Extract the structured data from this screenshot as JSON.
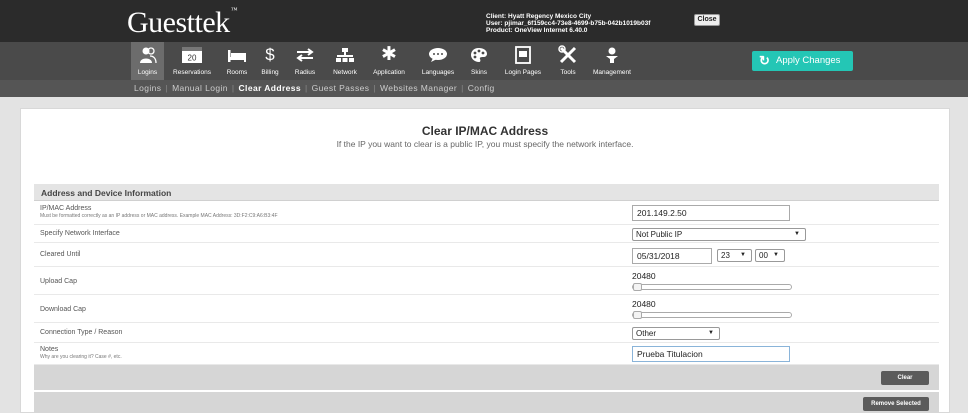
{
  "header": {
    "logo": "Guesttek",
    "trademark": "™",
    "client_line": "Client: Hyatt Regency Mexico City",
    "user_line": "User: pjimar_6f159cc4-73e8-4699-b75b-042b1019b03f",
    "product_line": "Product: OneView Internet 6.40.0",
    "close_label": "Close"
  },
  "nav": {
    "items": [
      {
        "label": "Logins",
        "icon": "users-icon"
      },
      {
        "label": "Reservations",
        "icon": "calendar-icon",
        "date": "20"
      },
      {
        "label": "Rooms",
        "icon": "bed-icon"
      },
      {
        "label": "Billing",
        "icon": "dollar-icon"
      },
      {
        "label": "Radius",
        "icon": "arrows-icon"
      },
      {
        "label": "Network",
        "icon": "network-icon"
      },
      {
        "label": "Application",
        "icon": "gear-icon"
      },
      {
        "label": "Languages",
        "icon": "chat-icon"
      },
      {
        "label": "Skins",
        "icon": "palette-icon"
      },
      {
        "label": "Login Pages",
        "icon": "page-icon"
      },
      {
        "label": "Tools",
        "icon": "tools-icon"
      },
      {
        "label": "Management",
        "icon": "management-icon"
      }
    ],
    "apply_label": "Apply Changes"
  },
  "subnav": {
    "items": [
      "Logins",
      "Manual Login",
      "Clear Address",
      "Guest Passes",
      "Websites Manager",
      "Config"
    ],
    "active": "Clear Address"
  },
  "page": {
    "title": "Clear IP/MAC Address",
    "subtitle": "If the IP you want to clear is a public IP, you must specify the network interface."
  },
  "form": {
    "section_title": "Address and Device Information",
    "ip_label": "IP/MAC Address",
    "ip_hint": "Must be formatted correctly as an IP address or MAC address. Example MAC Address: 3D:F2:C9:A6:B3:4F",
    "ip_value": "201.149.2.50",
    "interface_label": "Specify Network Interface",
    "interface_value": "Not Public IP",
    "cleared_label": "Cleared Until",
    "cleared_date": "05/31/2018",
    "cleared_hour": "23",
    "cleared_minute": "00",
    "upload_label": "Upload Cap",
    "upload_value": "20480",
    "download_label": "Download Cap",
    "download_value": "20480",
    "reason_label": "Connection Type / Reason",
    "reason_value": "Other",
    "notes_label": "Notes",
    "notes_hint": "Why are you clearing it? Case #, etc.",
    "notes_value": "Prueba Titulacion"
  },
  "actions": {
    "clear_label": "Clear",
    "remove_label": "Remove Selected"
  },
  "colors": {
    "header_bg": "#2b2b2b",
    "iconbar_bg": "#4a4a4a",
    "accent": "#24c6b5",
    "content_bg": "#e3e3e3"
  }
}
